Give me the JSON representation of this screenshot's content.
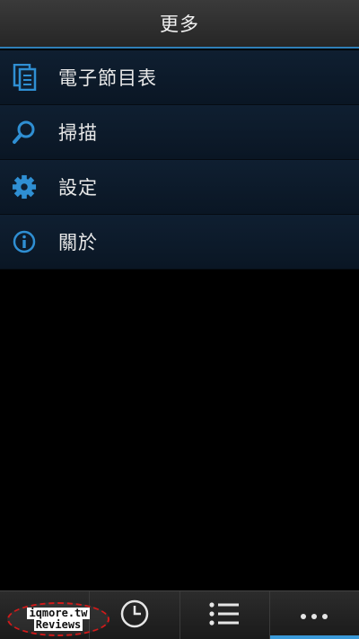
{
  "header": {
    "title": "更多"
  },
  "menu": {
    "items": [
      {
        "label": "電子節目表",
        "icon": "epg-document-icon"
      },
      {
        "label": "掃描",
        "icon": "search-icon"
      },
      {
        "label": "設定",
        "icon": "gear-icon"
      },
      {
        "label": "關於",
        "icon": "info-icon"
      }
    ]
  },
  "tabbar": {
    "tabs": [
      {
        "icon": "home-icon"
      },
      {
        "icon": "clock-icon"
      },
      {
        "icon": "list-icon"
      },
      {
        "icon": "more-icon",
        "active": true
      }
    ]
  },
  "watermark": {
    "line1": "iqmore.tw",
    "line2": "Reviews"
  },
  "colors": {
    "accent": "#3a9ad9",
    "menu_bg": "#0f1f31",
    "header_bg": "#333333"
  }
}
